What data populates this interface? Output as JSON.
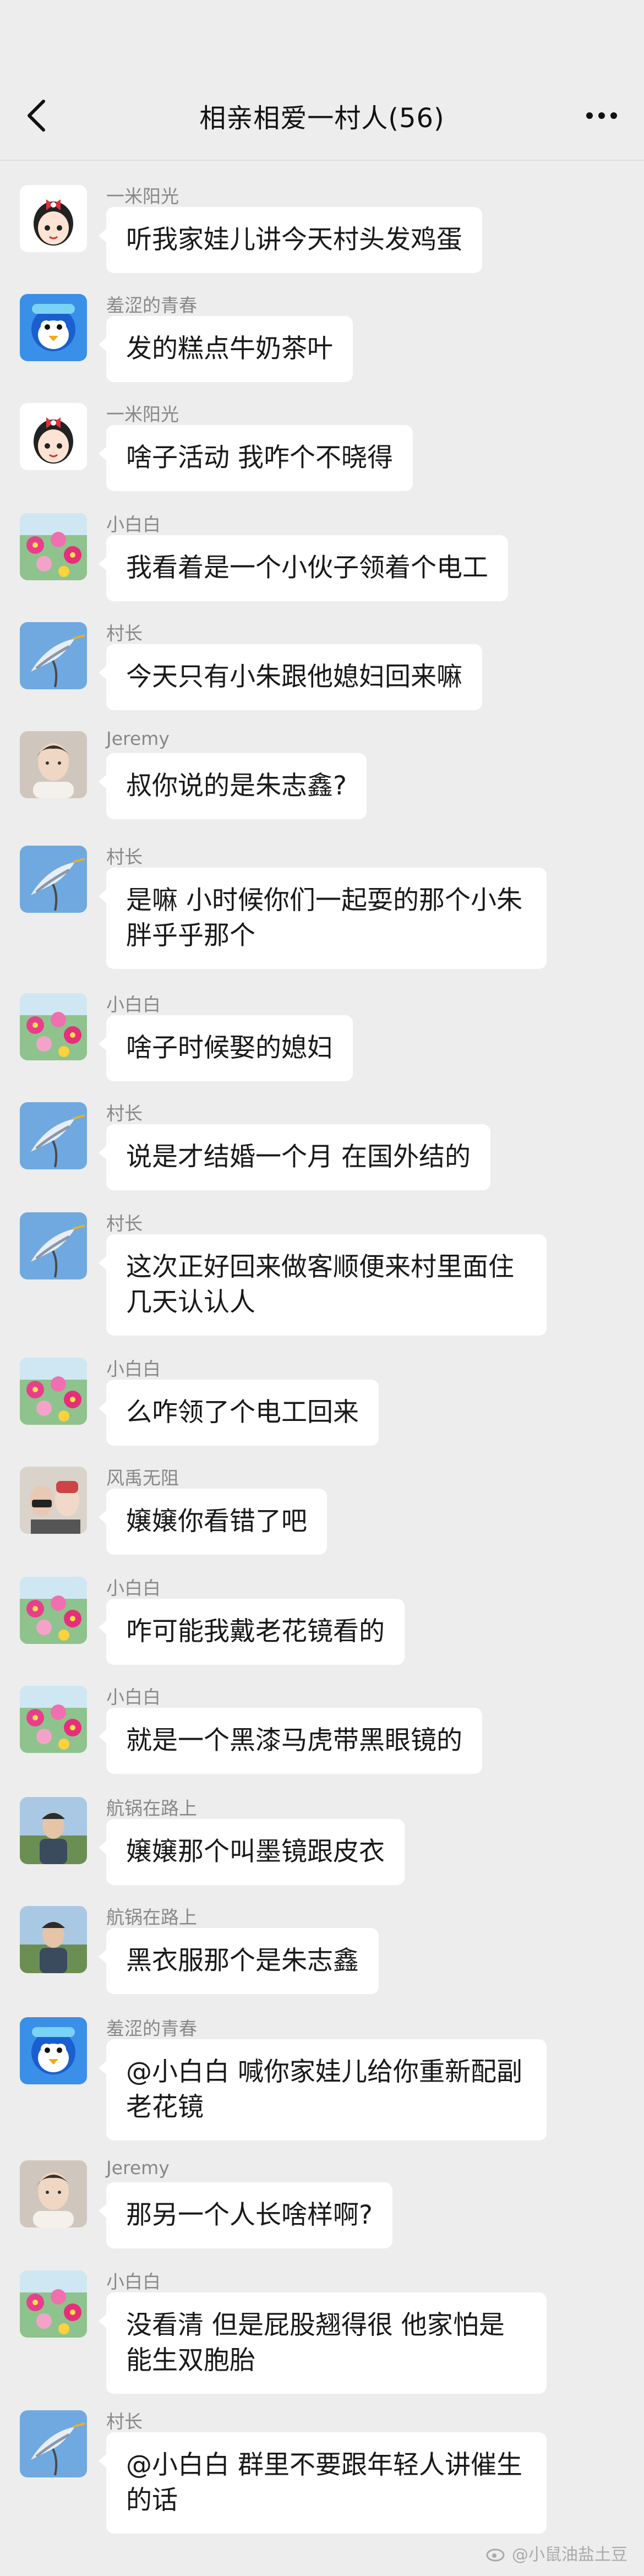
{
  "header": {
    "title": "相亲相爱一村人(56)"
  },
  "messages": [
    {
      "sender": "一米阳光",
      "text": "听我家娃儿讲今天村头发鸡蛋",
      "avatar": "girl-face"
    },
    {
      "sender": "羞涩的青春",
      "text": "发的糕点牛奶茶叶",
      "avatar": "penguin"
    },
    {
      "sender": "一米阳光",
      "text": "啥子活动 我咋个不晓得",
      "avatar": "girl-face"
    },
    {
      "sender": "小白白",
      "text": "我看着是一个小伙子领着个电工",
      "avatar": "flowers"
    },
    {
      "sender": "村长",
      "text": "今天只有小朱跟他媳妇回来嘛",
      "avatar": "heron"
    },
    {
      "sender": "Jeremy",
      "text": "叔你说的是朱志鑫?",
      "avatar": "portrait"
    },
    {
      "sender": "村长",
      "text": "是嘛 小时候你们一起耍的那个小朱 胖乎乎那个",
      "avatar": "heron"
    },
    {
      "sender": "小白白",
      "text": "啥子时候娶的媳妇",
      "avatar": "flowers"
    },
    {
      "sender": "村长",
      "text": "说是才结婚一个月 在国外结的",
      "avatar": "heron"
    },
    {
      "sender": "村长",
      "text": "这次正好回来做客顺便来村里面住几天认认人",
      "avatar": "heron"
    },
    {
      "sender": "小白白",
      "text": "么咋领了个电工回来",
      "avatar": "flowers"
    },
    {
      "sender": "风禹无阻",
      "text": "嬢嬢你看错了吧",
      "avatar": "selfie"
    },
    {
      "sender": "小白白",
      "text": "咋可能我戴老花镜看的",
      "avatar": "flowers"
    },
    {
      "sender": "小白白",
      "text": "就是一个黑漆马虎带黑眼镜的",
      "avatar": "flowers"
    },
    {
      "sender": "航锅在路上",
      "text": "嬢嬢那个叫墨镜跟皮衣",
      "avatar": "outdoor"
    },
    {
      "sender": "航锅在路上",
      "text": "黑衣服那个是朱志鑫",
      "avatar": "outdoor"
    },
    {
      "sender": "羞涩的青春",
      "text": "@小白白 喊你家娃儿给你重新配副老花镜",
      "avatar": "penguin"
    },
    {
      "sender": "Jeremy",
      "text": "那另一个人长啥样啊?",
      "avatar": "portrait"
    },
    {
      "sender": "小白白",
      "text": "没看清 但是屁股翘得很 他家怕是能生双胞胎",
      "avatar": "flowers"
    },
    {
      "sender": "村长",
      "text": "@小白白 群里不要跟年轻人讲催生的话",
      "avatar": "heron"
    }
  ],
  "watermark": {
    "text": "@小鼠油盐土豆"
  }
}
